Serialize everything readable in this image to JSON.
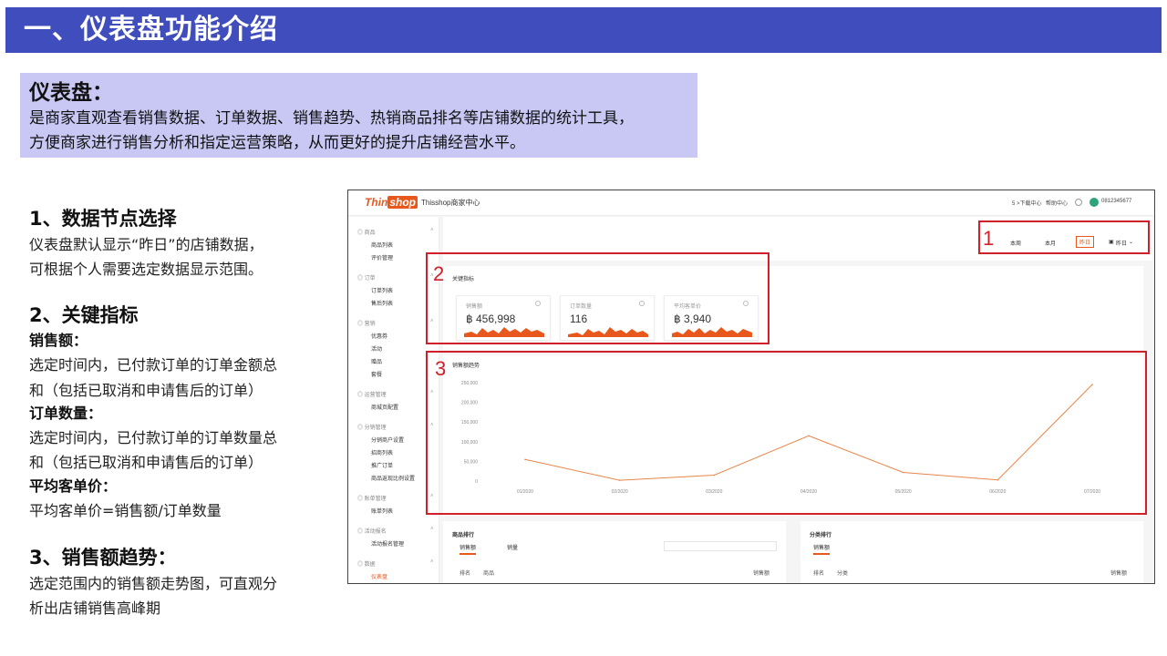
{
  "header": {
    "title": "一、仪表盘功能介绍"
  },
  "intro": {
    "title": "仪表盘：",
    "lines": [
      "是商家直观查看销售数据、订单数据、销售趋势、热销商品排名等店铺数据的统计工具，",
      "方便商家进行销售分析和指定运营策略，从而更好的提升店铺经营水平。"
    ]
  },
  "sections": {
    "s1": {
      "heading": "1、数据节点选择",
      "lines": [
        "仪表盘默认显示“昨日”的店铺数据，",
        "可根据个人需要选定数据显示范围。"
      ]
    },
    "s2": {
      "heading": "2、关键指标",
      "sales_title": "销售额：",
      "sales_lines": [
        "选定时间内，已付款订单的订单金额总",
        "和（包括已取消和申请售后的订单）"
      ],
      "orders_title": "订单数量：",
      "orders_lines": [
        "选定时间内，已付款订单的订单数量总",
        "和（包括已取消和申请售后的订单）"
      ],
      "avg_title": "平均客单价：",
      "avg_line": "平均客单价=销售额/订单数量"
    },
    "s3": {
      "heading": "3、销售额趋势：",
      "lines": [
        "选定范围内的销售额走势图，可直观分",
        "析出店铺销售高峰期"
      ]
    }
  },
  "screenshot": {
    "logo_thin": "Thin",
    "logo_shop": "shop",
    "app_title": "Thisshop商家中心",
    "topbar": {
      "download": "5 >下载中心",
      "help": "帮助中心",
      "phone": "0812345677"
    },
    "sidebar": [
      {
        "group": "商品",
        "items": [
          "商品列表",
          "评价管理"
        ]
      },
      {
        "group": "订单",
        "items": [
          "订单列表",
          "售后列表"
        ]
      },
      {
        "group": "营销",
        "items": [
          "优惠券",
          "活动",
          "赠品",
          "套餐"
        ]
      },
      {
        "group": "运营管理",
        "items": [
          "商城页配置"
        ]
      },
      {
        "group": "分销管理",
        "items": [
          "分销商户设置",
          "招商列表",
          "推广订单",
          "商品返现比例设置"
        ]
      },
      {
        "group": "账单管理",
        "items": [
          "账单列表"
        ]
      },
      {
        "group": "活动报名",
        "items": [
          "活动报名管理"
        ]
      },
      {
        "group": "数据",
        "items": [
          "仪表盘"
        ]
      }
    ],
    "filters": {
      "week": "本周",
      "month": "本月",
      "yesterday": "昨日",
      "date": "昨日"
    },
    "key_metrics": {
      "title": "关键指标",
      "items": [
        {
          "label": "销售额",
          "value": "฿ 456,998"
        },
        {
          "label": "订单数量",
          "value": "116"
        },
        {
          "label": "平均客单价",
          "value": "฿ 3,940"
        }
      ]
    },
    "trend_title": "销售额趋势",
    "product_rank": {
      "title": "商品排行",
      "tabs": [
        "销售额",
        "销量"
      ],
      "cols": [
        "排名",
        "商品",
        "销售额"
      ]
    },
    "category_rank": {
      "title": "分类排行",
      "tabs": [
        "销售额"
      ],
      "cols": [
        "排名",
        "分类",
        "销售额"
      ]
    },
    "markers": [
      "1",
      "2",
      "3"
    ]
  },
  "chart_data": {
    "type": "line",
    "title": "销售额趋势",
    "x": [
      "01/2020",
      "02/2020",
      "03/2020",
      "04/2020",
      "05/2020",
      "06/2020",
      "07/2020"
    ],
    "yticks": [
      "250,000",
      "200,000",
      "150,000",
      "100,000",
      "50,000",
      "0"
    ],
    "ylim": [
      0,
      250000
    ],
    "series": [
      {
        "values": [
          55000,
          2000,
          15000,
          115000,
          22000,
          3000,
          245000
        ]
      }
    ],
    "color": "#e8864a"
  }
}
